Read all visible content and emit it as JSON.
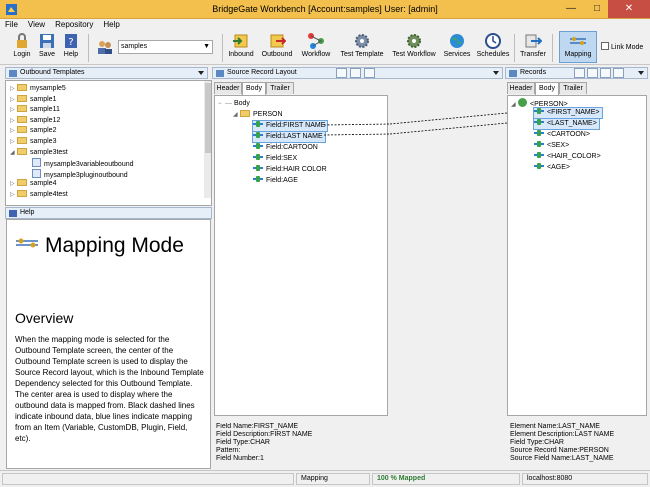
{
  "window": {
    "title": "BridgeGate Workbench [Account:samples] User: [admin]"
  },
  "menu": [
    "File",
    "View",
    "Repository",
    "Help"
  ],
  "toolbar": {
    "login": "Login",
    "save": "Save",
    "help": "Help",
    "account_value": "samples",
    "inbound": "Inbound",
    "outbound": "Outbound",
    "workflow": "Workflow",
    "test_template": "Test Template",
    "test_workflow": "Test Workflow",
    "services": "Services",
    "schedules": "Schedules",
    "transfer": "Transfer",
    "mapping": "Mapping",
    "link_mode": "Link Mode"
  },
  "outbound_templates": {
    "title": "Outbound Templates",
    "items": [
      "mysample5",
      "sample1",
      "sample11",
      "sample12",
      "sample2",
      "sample3",
      "sample3test",
      "mysample3variableoutbound",
      "mysample3pluginoutbound",
      "sample4",
      "sample4test"
    ]
  },
  "help": {
    "title": "Help",
    "heading": "Mapping Mode",
    "overview": "Overview",
    "body": "When the mapping mode is selected for the Outbound Template screen, the center of the Outbound Template screen is used to display the Source Record layout, which is the Inbound Template Dependency selected for this Outbound Template. The center area is used to display where the outbound data is mapped from. Black dashed lines indicate inbound data, blue lines indicate mapping from an Item (Variable, CustomDB, Plugin, Field, etc)."
  },
  "source_layout": {
    "title": "Source Record Layout",
    "tabs": [
      "Header",
      "Body",
      "Trailer"
    ],
    "root": "Body",
    "group": "PERSON",
    "fields": [
      "Field:FIRST NAME",
      "Field:LAST NAME",
      "Field:CARTOON",
      "Field:SEX",
      "Field:HAIR COLOR",
      "Field:AGE"
    ],
    "info": [
      "Field Name:FIRST_NAME",
      "Field Description:FIRST NAME",
      "Field Type:CHAR",
      "Pattern:",
      "Field Number:1"
    ]
  },
  "records": {
    "title": "Records",
    "tabs": [
      "Header",
      "Body",
      "Trailer"
    ],
    "root": "<PERSON>",
    "elements": [
      "<FIRST_NAME>",
      "<LAST_NAME>",
      "<CARTOON>",
      "<SEX>",
      "<HAIR_COLOR>",
      "<AGE>"
    ],
    "info": [
      "Element Name:LAST_NAME",
      "Element Description:LAST NAME",
      "Field Type:CHAR",
      "Source Record Name:PERSON",
      "Source Field Name:LAST_NAME"
    ]
  },
  "status": {
    "mode": "Mapping",
    "mapped": "100 %  Mapped",
    "server": "localhost:8080"
  }
}
